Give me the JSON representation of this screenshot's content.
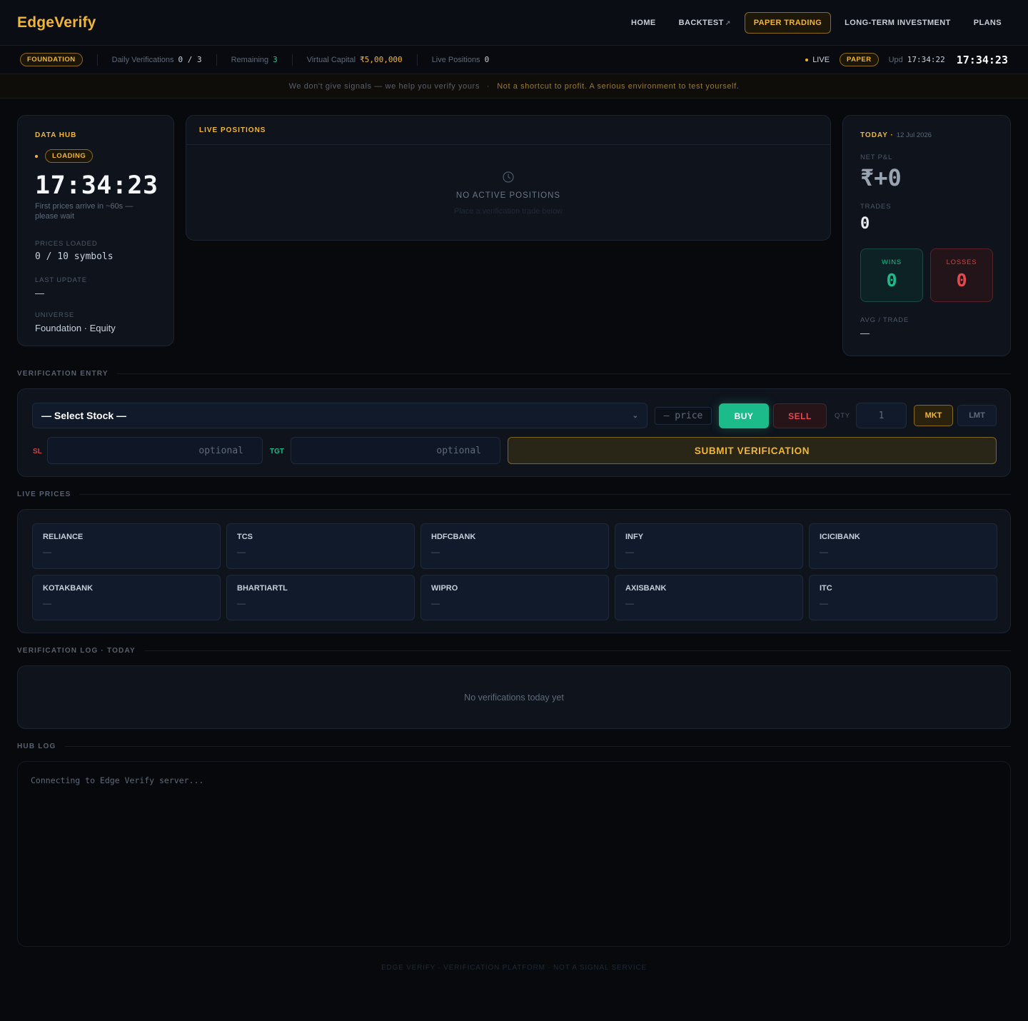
{
  "brand": "EdgeVerify",
  "nav": [
    {
      "label": "HOME",
      "active": false
    },
    {
      "label": "BACKTEST",
      "active": false,
      "external": "↗"
    },
    {
      "label": "PAPER TRADING",
      "active": true
    },
    {
      "label": "LONG-TERM INVESTMENT",
      "active": false
    },
    {
      "label": "PLANS",
      "active": false
    }
  ],
  "status": {
    "plan": "FOUNDATION",
    "daily_label": "Daily Verifications",
    "daily_value": "0 / 3",
    "remaining_label": "Remaining",
    "remaining_value": "3",
    "capital_label": "Virtual Capital",
    "capital_value": "₹5,00,000",
    "positions_label": "Live Positions",
    "positions_value": "0",
    "live": "LIVE",
    "mode": "PAPER",
    "upd_label": "Upd",
    "upd_value": "17:34:22",
    "clock": "17:34:23"
  },
  "disclaimer": {
    "left": "We don't give signals — we help you verify yours",
    "sep": "·",
    "right": "Not a shortcut to profit. A serious environment to test yourself."
  },
  "hub": {
    "title": "DATA HUB",
    "state": "LOADING",
    "clock": "17:34:23",
    "note": "First prices arrive in ~60s — please wait",
    "prices_loaded_label": "PRICES LOADED",
    "prices_loaded_value": "0 / 10 symbols",
    "last_update_label": "LAST UPDATE",
    "last_update_value": "—",
    "universe_label": "UNIVERSE",
    "universe_value": "Foundation · Equity"
  },
  "positions": {
    "title": "LIVE POSITIONS",
    "empty_title": "NO ACTIVE POSITIONS",
    "empty_sub": "Place a verification trade below"
  },
  "today": {
    "title": "TODAY ·",
    "date": "12 Jul 2026",
    "pnl_label": "NET P&L",
    "pnl_value": "₹+0",
    "trades_label": "TRADES",
    "trades_value": "0",
    "wins_label": "WINS",
    "wins_value": "0",
    "losses_label": "LOSSES",
    "losses_value": "0",
    "avg_label": "AVG / TRADE",
    "avg_value": "—"
  },
  "entry": {
    "section": "VERIFICATION ENTRY",
    "stock_placeholder": "— Select Stock —",
    "price_placeholder": "— price",
    "buy": "BUY",
    "sell": "SELL",
    "qty_label": "QTY",
    "qty_value": "1",
    "mkt": "MKT",
    "lmt": "LMT",
    "sl_label": "SL",
    "sl_placeholder": "optional",
    "tgt_label": "TGT",
    "tgt_placeholder": "optional",
    "submit": "SUBMIT VERIFICATION"
  },
  "prices": {
    "section": "LIVE PRICES",
    "symbols": [
      {
        "name": "RELIANCE",
        "value": "—"
      },
      {
        "name": "TCS",
        "value": "—"
      },
      {
        "name": "HDFCBANK",
        "value": "—"
      },
      {
        "name": "INFY",
        "value": "—"
      },
      {
        "name": "ICICIBANK",
        "value": "—"
      },
      {
        "name": "KOTAKBANK",
        "value": "—"
      },
      {
        "name": "BHARTIARTL",
        "value": "—"
      },
      {
        "name": "WIPRO",
        "value": "—"
      },
      {
        "name": "AXISBANK",
        "value": "—"
      },
      {
        "name": "ITC",
        "value": "—"
      }
    ]
  },
  "vlog": {
    "section": "VERIFICATION LOG · TODAY",
    "empty": "No verifications today yet"
  },
  "hublog": {
    "section": "HUB LOG",
    "line": "Connecting to Edge Verify server..."
  },
  "footer": "EDGE VERIFY · VERIFICATION PLATFORM · NOT A SIGNAL SERVICE",
  "icons": {
    "positions_empty": "clock-icon",
    "select": "chevron-down-icon",
    "external": "external-link-icon"
  },
  "colors": {
    "accent": "#f2b632",
    "buy": "#1bbc8a",
    "sell": "#e5484d",
    "bg": "#07090d",
    "card": "#0e131c"
  }
}
